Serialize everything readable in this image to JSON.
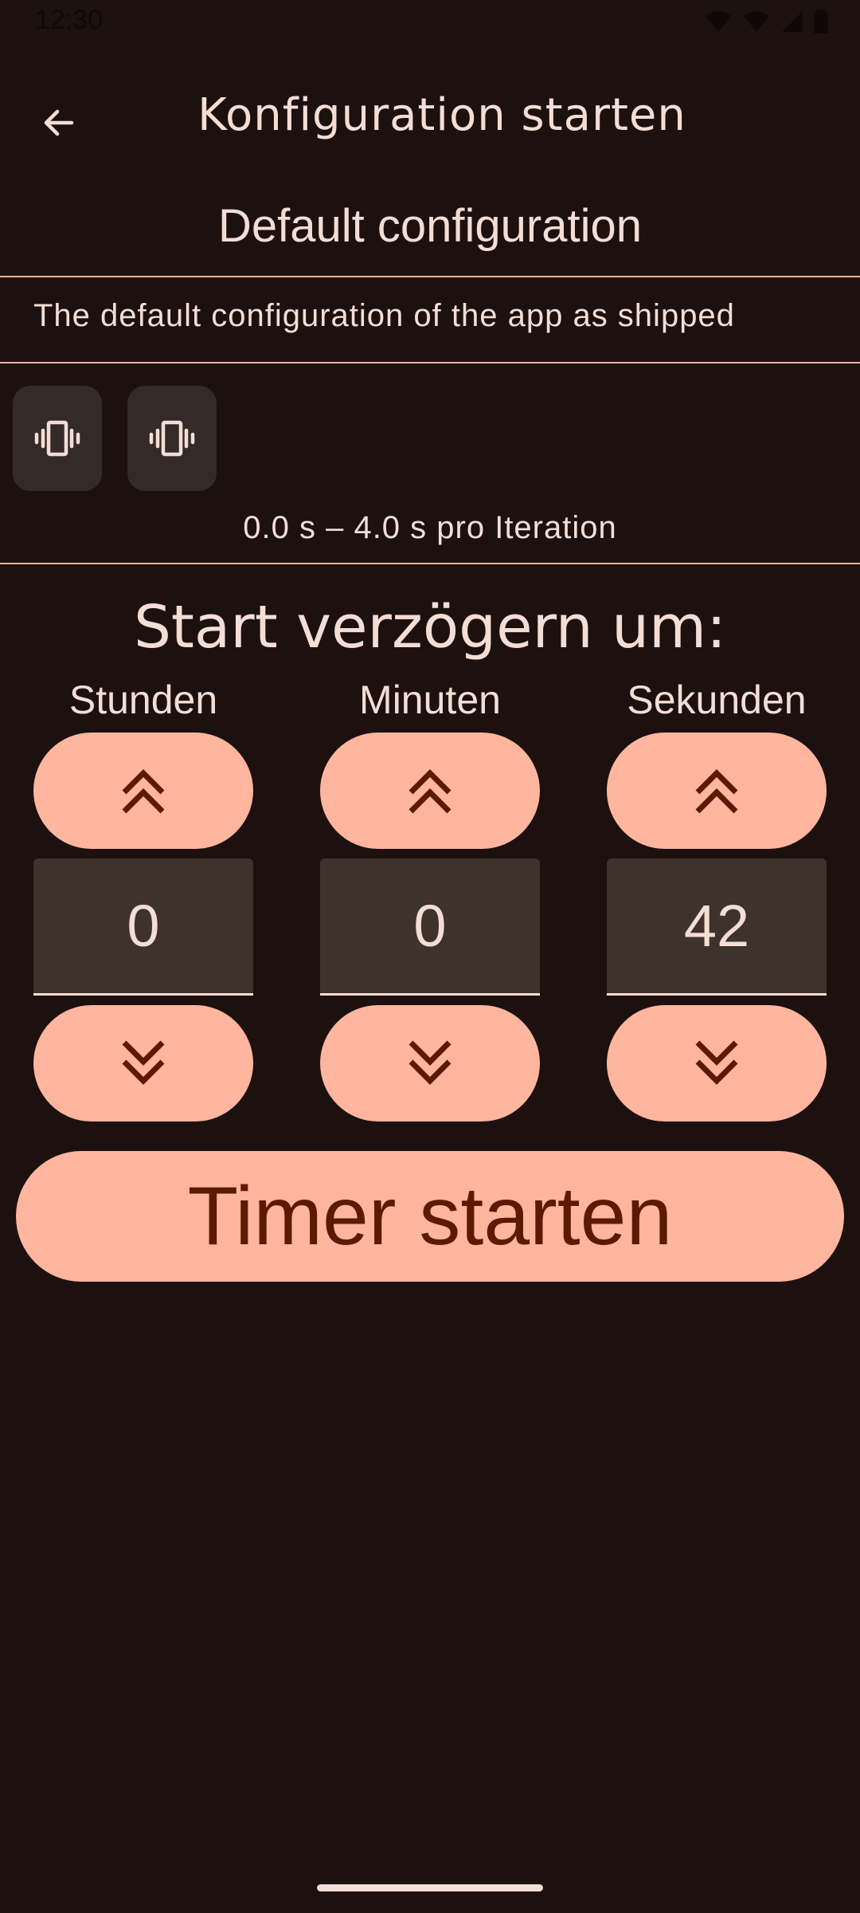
{
  "status_bar": {
    "time": "12:30"
  },
  "top_bar": {
    "title": "Konfiguration starten",
    "back_icon": "arrow-left-icon"
  },
  "config": {
    "name": "Default configuration",
    "description": "The default configuration of the app as shipped",
    "vibration_buttons": [
      "vibration-icon",
      "vibration-icon"
    ],
    "iteration_text": "0.0 s – 4.0 s pro Iteration"
  },
  "delay": {
    "heading": "Start verzögern um:",
    "columns": [
      {
        "label": "Stunden",
        "value": "0"
      },
      {
        "label": "Minuten",
        "value": "0"
      },
      {
        "label": "Sekunden",
        "value": "42"
      }
    ]
  },
  "start_button": {
    "label": "Timer starten"
  },
  "colors": {
    "background": "#1c110e",
    "accent": "#ffb59e",
    "on_accent": "#5c1a05",
    "text": "#f3ddd5",
    "divider": "#f0b29f",
    "field": "#3e322d"
  }
}
